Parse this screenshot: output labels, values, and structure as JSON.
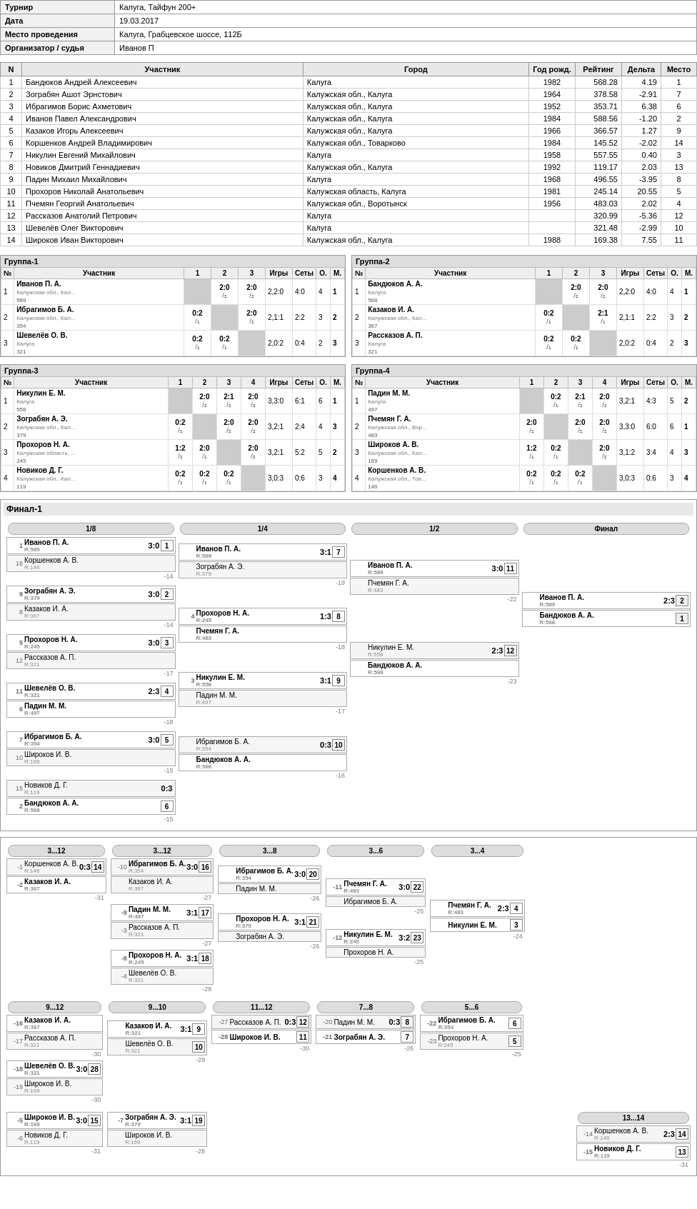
{
  "tournament": {
    "title": "Калуга, Тайфун 200+",
    "date": "19.03.2017",
    "venue": "Калуга, Грабцевское шоссе, 112Б",
    "organizer": "Иванов П"
  },
  "table_headers": {
    "n": "N",
    "participant": "Участник",
    "city": "Город",
    "birth": "Год рожд.",
    "rating": "Рейтинг",
    "delta": "Дельта",
    "place": "Место"
  },
  "participants": [
    {
      "n": 1,
      "name": "Бандюков Андрей Алексеевич",
      "city": "Калуга",
      "birth": "1982",
      "rating": "568.28",
      "delta": "4.19",
      "place": "1"
    },
    {
      "n": 2,
      "name": "Зограбян Ашот Эрнстович",
      "city": "Калужская обл., Калуга",
      "birth": "1964",
      "rating": "378.58",
      "delta": "-2.91",
      "place": "7"
    },
    {
      "n": 3,
      "name": "Ибрагимов Борис Ахметович",
      "city": "Калужская обл., Калуга",
      "birth": "1952",
      "rating": "353.71",
      "delta": "6.38",
      "place": "6"
    },
    {
      "n": 4,
      "name": "Иванов Павел Александрович",
      "city": "Калужская обл., Калуга",
      "birth": "1984",
      "rating": "588.56",
      "delta": "-1.20",
      "place": "2"
    },
    {
      "n": 5,
      "name": "Казаков Игорь Алексеевич",
      "city": "Калужская обл., Калуга",
      "birth": "1966",
      "rating": "366.57",
      "delta": "1.27",
      "place": "9"
    },
    {
      "n": 6,
      "name": "Коршенков Андрей Владимирович",
      "city": "Калужская обл., Товарково",
      "birth": "1984",
      "rating": "145.52",
      "delta": "-2.02",
      "place": "14"
    },
    {
      "n": 7,
      "name": "Никулин Евгений Михайлович",
      "city": "Калуга",
      "birth": "1958",
      "rating": "557.55",
      "delta": "0.40",
      "place": "3"
    },
    {
      "n": 8,
      "name": "Новиков Дмитрий Геннадиевич",
      "city": "Калужская обл., Калуга",
      "birth": "1992",
      "rating": "119.17",
      "delta": "2.03",
      "place": "13"
    },
    {
      "n": 9,
      "name": "Падин Михаил Михайлович",
      "city": "Калуга",
      "birth": "1968",
      "rating": "496.55",
      "delta": "-3.95",
      "place": "8"
    },
    {
      "n": 10,
      "name": "Прохоров Николай Анатольевич",
      "city": "Калужская область, Калуга",
      "birth": "1981",
      "rating": "245.14",
      "delta": "20.55",
      "place": "5"
    },
    {
      "n": 11,
      "name": "Пчемян Георгий Анатольевич",
      "city": "Калужская обл., Воротынск",
      "birth": "1956",
      "rating": "483.03",
      "delta": "2.02",
      "place": "4"
    },
    {
      "n": 12,
      "name": "Рассказов Анатолий Петрович",
      "city": "Калуга",
      "birth": "",
      "rating": "320.99",
      "delta": "-5.36",
      "place": "12"
    },
    {
      "n": 13,
      "name": "Шевелёв Олег Викторович",
      "city": "Калуга",
      "birth": "",
      "rating": "321.48",
      "delta": "-2.99",
      "place": "10"
    },
    {
      "n": 14,
      "name": "Широков Иван Викторович",
      "city": "Калужская обл., Калуга",
      "birth": "1988",
      "rating": "169.38",
      "delta": "7.55",
      "place": "11"
    }
  ],
  "groups": {
    "group1": {
      "title": "Группа-1",
      "headers": [
        "№",
        "Участник",
        "1",
        "2",
        "3",
        "Игры",
        "Сеты",
        "О.",
        "М."
      ],
      "players": [
        {
          "n": "1",
          "name": "Иванов П. А.",
          "sub": "Калужская обл., Кал...",
          "rating": "589",
          "s1": "—",
          "s2": "2:0/₂",
          "s3": "2:0/₂",
          "games": "2,2:0",
          "sets": "4:0",
          "o": "4",
          "m": "1"
        },
        {
          "n": "2",
          "name": "Ибрагимов Б. А.",
          "sub": "Калужская обл., Кал...",
          "rating": "354",
          "s1": "0:2/₁",
          "s2": "—",
          "s3": "2:0/₂",
          "games": "2,1:1",
          "sets": "2:2",
          "o": "3",
          "m": "2"
        },
        {
          "n": "3",
          "name": "Шевелёв О. В.",
          "sub": "Калуга",
          "rating": "321",
          "s1": "0:2/₁",
          "s2": "0:2/₁",
          "s3": "—",
          "games": "2,0:2",
          "sets": "0:4",
          "o": "2",
          "m": "3"
        }
      ]
    },
    "group2": {
      "title": "Группа-2",
      "headers": [
        "№",
        "Участник",
        "1",
        "2",
        "3",
        "Игры",
        "Сеты",
        "О.",
        "М."
      ],
      "players": [
        {
          "n": "1",
          "name": "Бандюков А. А.",
          "sub": "Калуга",
          "rating": "568",
          "s1": "—",
          "s2": "2:0/₂",
          "s3": "2:0/₂",
          "games": "2,2:0",
          "sets": "4:0",
          "o": "4",
          "m": "1"
        },
        {
          "n": "2",
          "name": "Казаков И. А.",
          "sub": "Калужская обл., Кал...",
          "rating": "367",
          "s1": "0:2/₁",
          "s2": "—",
          "s3": "2:1/₁",
          "games": "2,1:1",
          "sets": "2:2",
          "o": "3",
          "m": "2"
        },
        {
          "n": "3",
          "name": "Рассказов А. П.",
          "sub": "Калуга",
          "rating": "321",
          "s1": "0:2/₁",
          "s2": "0:2/₁",
          "s3": "—",
          "games": "2,0:2",
          "sets": "0:4",
          "o": "2",
          "m": "3"
        }
      ]
    },
    "group3": {
      "title": "Группа-3",
      "headers": [
        "№",
        "Участник",
        "1",
        "2",
        "3",
        "4",
        "Игры",
        "Сеты",
        "О.",
        "М."
      ],
      "players": [
        {
          "n": "1",
          "name": "Никулин Е. М.",
          "sub": "Калуга",
          "rating": "558",
          "s1": "—",
          "s2": "2:0/₂",
          "s3": "2:1/₂",
          "s4": "2:0/₂",
          "games": "3,3:0",
          "sets": "6:1",
          "o": "6",
          "m": "1"
        },
        {
          "n": "2",
          "name": "Зограбян А. Э.",
          "sub": "Калужская обл., Кал...",
          "rating": "379",
          "s1": "0:2/₁",
          "s2": "—",
          "s3": "2:0/₂",
          "s4": "2:0/₂",
          "games": "3,2:1",
          "sets": "2:4",
          "o": "4",
          "m": "3"
        },
        {
          "n": "3",
          "name": "Прохоров Н. А.",
          "sub": "Калужская область, ...",
          "rating": "245",
          "s1": "1:2/₂",
          "s2": "2:0/₁",
          "s3": "—",
          "s4": "2:0/₂",
          "games": "3,2:1",
          "sets": "5:2",
          "o": "5",
          "m": "2"
        },
        {
          "n": "4",
          "name": "Новиков Д. Г.",
          "sub": "Калужская обл., Кал...",
          "rating": "119",
          "s1": "0:2/₁",
          "s2": "0:2/₁",
          "s3": "0:2/₁",
          "s4": "—",
          "games": "3,0:3",
          "sets": "0:6",
          "o": "3",
          "m": "4"
        }
      ]
    },
    "group4": {
      "title": "Группа-4",
      "headers": [
        "№",
        "Участник",
        "1",
        "2",
        "3",
        "4",
        "Игры",
        "Сеты",
        "О.",
        "М."
      ],
      "players": [
        {
          "n": "1",
          "name": "Падин М. М.",
          "sub": "Калуга",
          "rating": "497",
          "s1": "—",
          "s2": "0:2/₁",
          "s3": "2:1/₂",
          "s4": "2:0/₂",
          "games": "3,2:1",
          "sets": "4:3",
          "o": "5",
          "m": "2"
        },
        {
          "n": "2",
          "name": "Пчемян Г. А.",
          "sub": "Калужская обл., Вор...",
          "rating": "483",
          "s1": "2:0/₂",
          "s2": "—",
          "s3": "2:0/₂",
          "s4": "2:0/₂",
          "games": "3,3:0",
          "sets": "6:0",
          "o": "6",
          "m": "1"
        },
        {
          "n": "3",
          "name": "Широков А. В.",
          "sub": "Калужская обл., Кал...",
          "rating": "169",
          "s1": "1:2/₁",
          "s2": "0:2/₁",
          "s3": "—",
          "s4": "2:0/₂",
          "games": "3,1:2",
          "sets": "3:4",
          "o": "4",
          "m": "3"
        },
        {
          "n": "4",
          "name": "Коршенков А. В.",
          "sub": "Калужская обл., Тов...",
          "rating": "146",
          "s1": "0:2/₁",
          "s2": "0:2/₁",
          "s3": "0:2/₁",
          "s4": "—",
          "games": "3,0:3",
          "sets": "0:6",
          "o": "3",
          "m": "4"
        }
      ]
    }
  },
  "final1": {
    "title": "Финал-1",
    "rounds": [
      "1/8",
      "1/4",
      "1/2",
      "Финал"
    ]
  },
  "playoffs_lower": {
    "sections": [
      "3...12",
      "3...12",
      "3...8",
      "3...6",
      "3...4",
      "9...12",
      "9...10",
      "11...12",
      "7...8",
      "5...6",
      "13...14"
    ]
  },
  "colors": {
    "header_bg": "#e8e8e8",
    "border": "#999",
    "winner_bg": "#ffffff",
    "loser_bg": "#f0f0f0",
    "group_bg": "#dddddd",
    "self_cell": "#cccccc"
  }
}
